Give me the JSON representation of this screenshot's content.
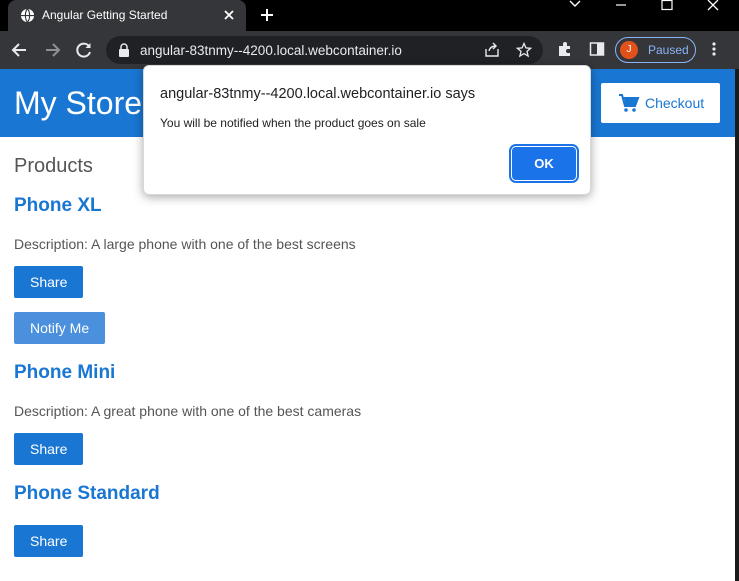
{
  "browser": {
    "tab_title": "Angular Getting Started",
    "url": "angular-83tnmy--4200.local.webcontainer.io",
    "profile": {
      "initial": "J",
      "label": "Paused"
    }
  },
  "store": {
    "title": "My Store",
    "checkout_label": "Checkout",
    "section_title": "Products",
    "products": [
      {
        "name": "Phone XL",
        "description": "Description: A large phone with one of the best screens",
        "share_label": "Share",
        "notify_label": "Notify Me"
      },
      {
        "name": "Phone Mini",
        "description": "Description: A great phone with one of the best cameras",
        "share_label": "Share"
      },
      {
        "name": "Phone Standard",
        "share_label": "Share"
      }
    ]
  },
  "dialog": {
    "title": "angular-83tnmy--4200.local.webcontainer.io says",
    "message": "You will be notified when the product goes on sale",
    "ok_label": "OK"
  },
  "colors": {
    "primary": "#1976d2",
    "dialog_button": "#1a73e8",
    "chrome_dark": "#35363a"
  }
}
